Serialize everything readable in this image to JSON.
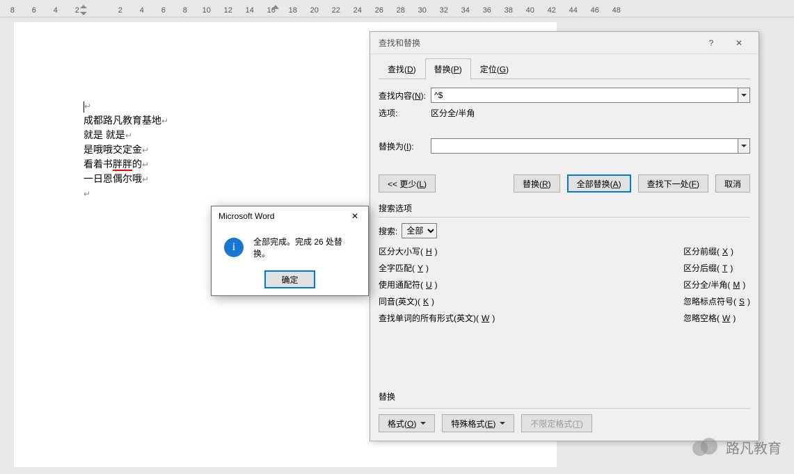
{
  "ruler": {
    "marks": [
      "8",
      "",
      "6",
      "",
      "4",
      "",
      "2",
      "",
      "",
      "",
      "2",
      "",
      "4",
      "",
      "6",
      "",
      "8",
      "",
      "10",
      "",
      "12",
      "",
      "14",
      "",
      "16",
      "",
      "18",
      "",
      "20",
      "",
      "22",
      "",
      "24",
      "",
      "26",
      "",
      "28",
      "",
      "30",
      "",
      "32",
      "",
      "34",
      "",
      "36",
      "",
      "38",
      "",
      "40",
      "",
      "42",
      "",
      "44",
      "",
      "46",
      "",
      "48"
    ]
  },
  "document": {
    "lines": [
      "成都路凡教育基地",
      "就是   就是",
      "是哦哦交定金",
      "看着书胖胖的",
      "一日恩偶尔哦"
    ]
  },
  "dialog": {
    "title": "查找和替换",
    "tabs": {
      "find": "查找(D)",
      "replace": "替换(P)",
      "goto": "定位(G)"
    },
    "findLabel": "查找内容(N):",
    "findValue": "^$",
    "optionsLabel": "选项:",
    "optionsValue": "区分全/半角",
    "replaceLabel": "替换为(I):",
    "replaceValue": "",
    "buttons": {
      "less": "<< 更少(L)",
      "replace": "替换(R)",
      "replaceAll": "全部替换(A)",
      "findNext": "查找下一处(F)",
      "cancel": "取消"
    },
    "searchOptionsLabel": "搜索选项",
    "searchLabel": "搜索:",
    "searchValue": "全部",
    "checks": {
      "matchCase": "区分大小写(H)",
      "wholeWord": "全字匹配(Y)",
      "wildcard": "使用通配符(U)",
      "soundsLike": "同音(英文)(K)",
      "allForms": "查找单词的所有形式(英文)(W)",
      "prefix": "区分前缀(X)",
      "suffix": "区分后缀(T)",
      "fullHalf": "区分全/半角(M)",
      "ignorePunct": "忽略标点符号(S)",
      "ignoreSpace": "忽略空格(W)"
    },
    "bottomLabel": "替换",
    "bottomButtons": {
      "format": "格式(O)",
      "special": "特殊格式(E)",
      "noFormat": "不限定格式(T)"
    }
  },
  "msgbox": {
    "title": "Microsoft Word",
    "message": "全部完成。完成 26 处替换。",
    "ok": "确定"
  },
  "watermark": "路凡教育"
}
